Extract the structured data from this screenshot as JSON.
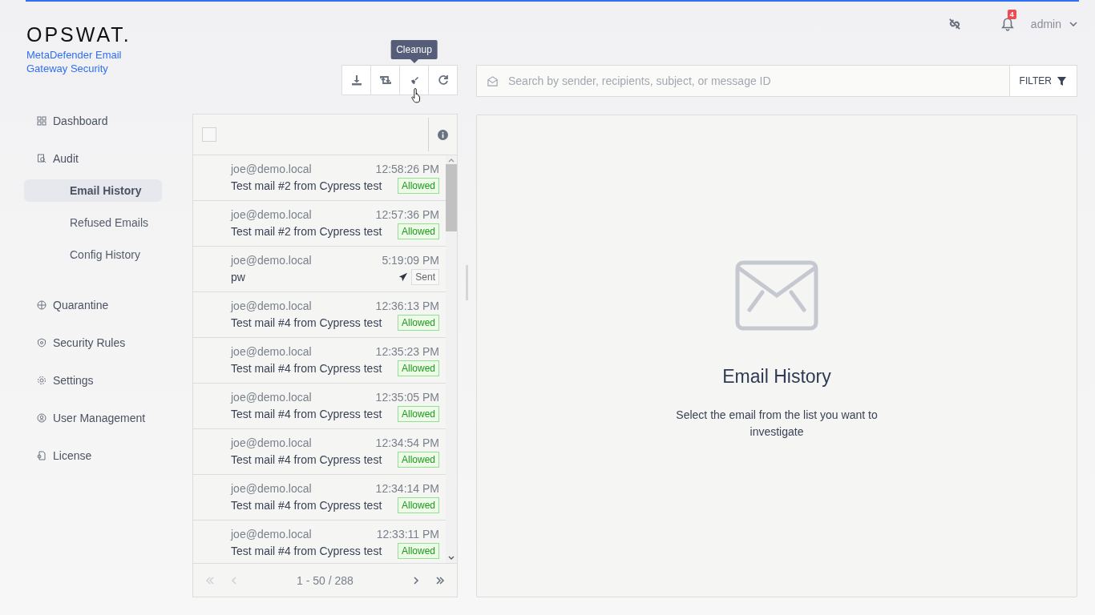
{
  "brand": {
    "logo": "OPSWAT.",
    "product": "MetaDefender Email Gateway Security"
  },
  "header": {
    "notification_count": "4",
    "user": "admin"
  },
  "sidebar": {
    "items": [
      {
        "kind": "dashboard",
        "label": "Dashboard",
        "selected": false
      },
      {
        "kind": "audit",
        "label": "Audit",
        "selected": false,
        "children": [
          {
            "label": "Email History",
            "selected": true
          },
          {
            "label": "Refused Emails",
            "selected": false
          },
          {
            "label": "Config History",
            "selected": false
          }
        ]
      },
      {
        "kind": "quarantine",
        "label": "Quarantine",
        "selected": false
      },
      {
        "kind": "shield",
        "label": "Security Rules",
        "selected": false
      },
      {
        "kind": "gear",
        "label": "Settings",
        "selected": false
      },
      {
        "kind": "user",
        "label": "User Management",
        "selected": false
      },
      {
        "kind": "license",
        "label": "License",
        "selected": false
      }
    ]
  },
  "toolbar": {
    "buttons": [
      {
        "kind": "download"
      },
      {
        "kind": "retweet"
      },
      {
        "kind": "cleanup",
        "tooltip": "Cleanup"
      },
      {
        "kind": "refresh"
      }
    ]
  },
  "search": {
    "placeholder": "Search by sender, recipients, subject, or message ID",
    "filter_label": "FILTER"
  },
  "list": {
    "select_all_checked": false,
    "emails": [
      {
        "sender": "joe@demo.local",
        "time": "12:58:26 PM",
        "subject": "Test mail #2 from Cypress test",
        "status": "Allowed",
        "kind": "allowed"
      },
      {
        "sender": "joe@demo.local",
        "time": "12:57:36 PM",
        "subject": "Test mail #2 from Cypress test",
        "status": "Allowed",
        "kind": "allowed"
      },
      {
        "sender": "joe@demo.local",
        "time": "5:19:09 PM",
        "subject": "pw",
        "status": "Sent",
        "kind": "sent"
      },
      {
        "sender": "joe@demo.local",
        "time": "12:36:13 PM",
        "subject": "Test mail #4 from Cypress test",
        "status": "Allowed",
        "kind": "allowed"
      },
      {
        "sender": "joe@demo.local",
        "time": "12:35:23 PM",
        "subject": "Test mail #4 from Cypress test",
        "status": "Allowed",
        "kind": "allowed"
      },
      {
        "sender": "joe@demo.local",
        "time": "12:35:05 PM",
        "subject": "Test mail #4 from Cypress test",
        "status": "Allowed",
        "kind": "allowed"
      },
      {
        "sender": "joe@demo.local",
        "time": "12:34:54 PM",
        "subject": "Test mail #4 from Cypress test",
        "status": "Allowed",
        "kind": "allowed"
      },
      {
        "sender": "joe@demo.local",
        "time": "12:34:14 PM",
        "subject": "Test mail #4 from Cypress test",
        "status": "Allowed",
        "kind": "allowed"
      },
      {
        "sender": "joe@demo.local",
        "time": "12:33:11 PM",
        "subject": "Test mail #4 from Cypress test",
        "status": "Allowed",
        "kind": "allowed"
      }
    ],
    "pagination": {
      "range": "1 - 50 / 288",
      "first_disabled": true,
      "prev_disabled": true,
      "next_disabled": false,
      "last_disabled": false
    }
  },
  "detail": {
    "title": "Email History",
    "message": "Select the email from the list you want to investigate"
  }
}
